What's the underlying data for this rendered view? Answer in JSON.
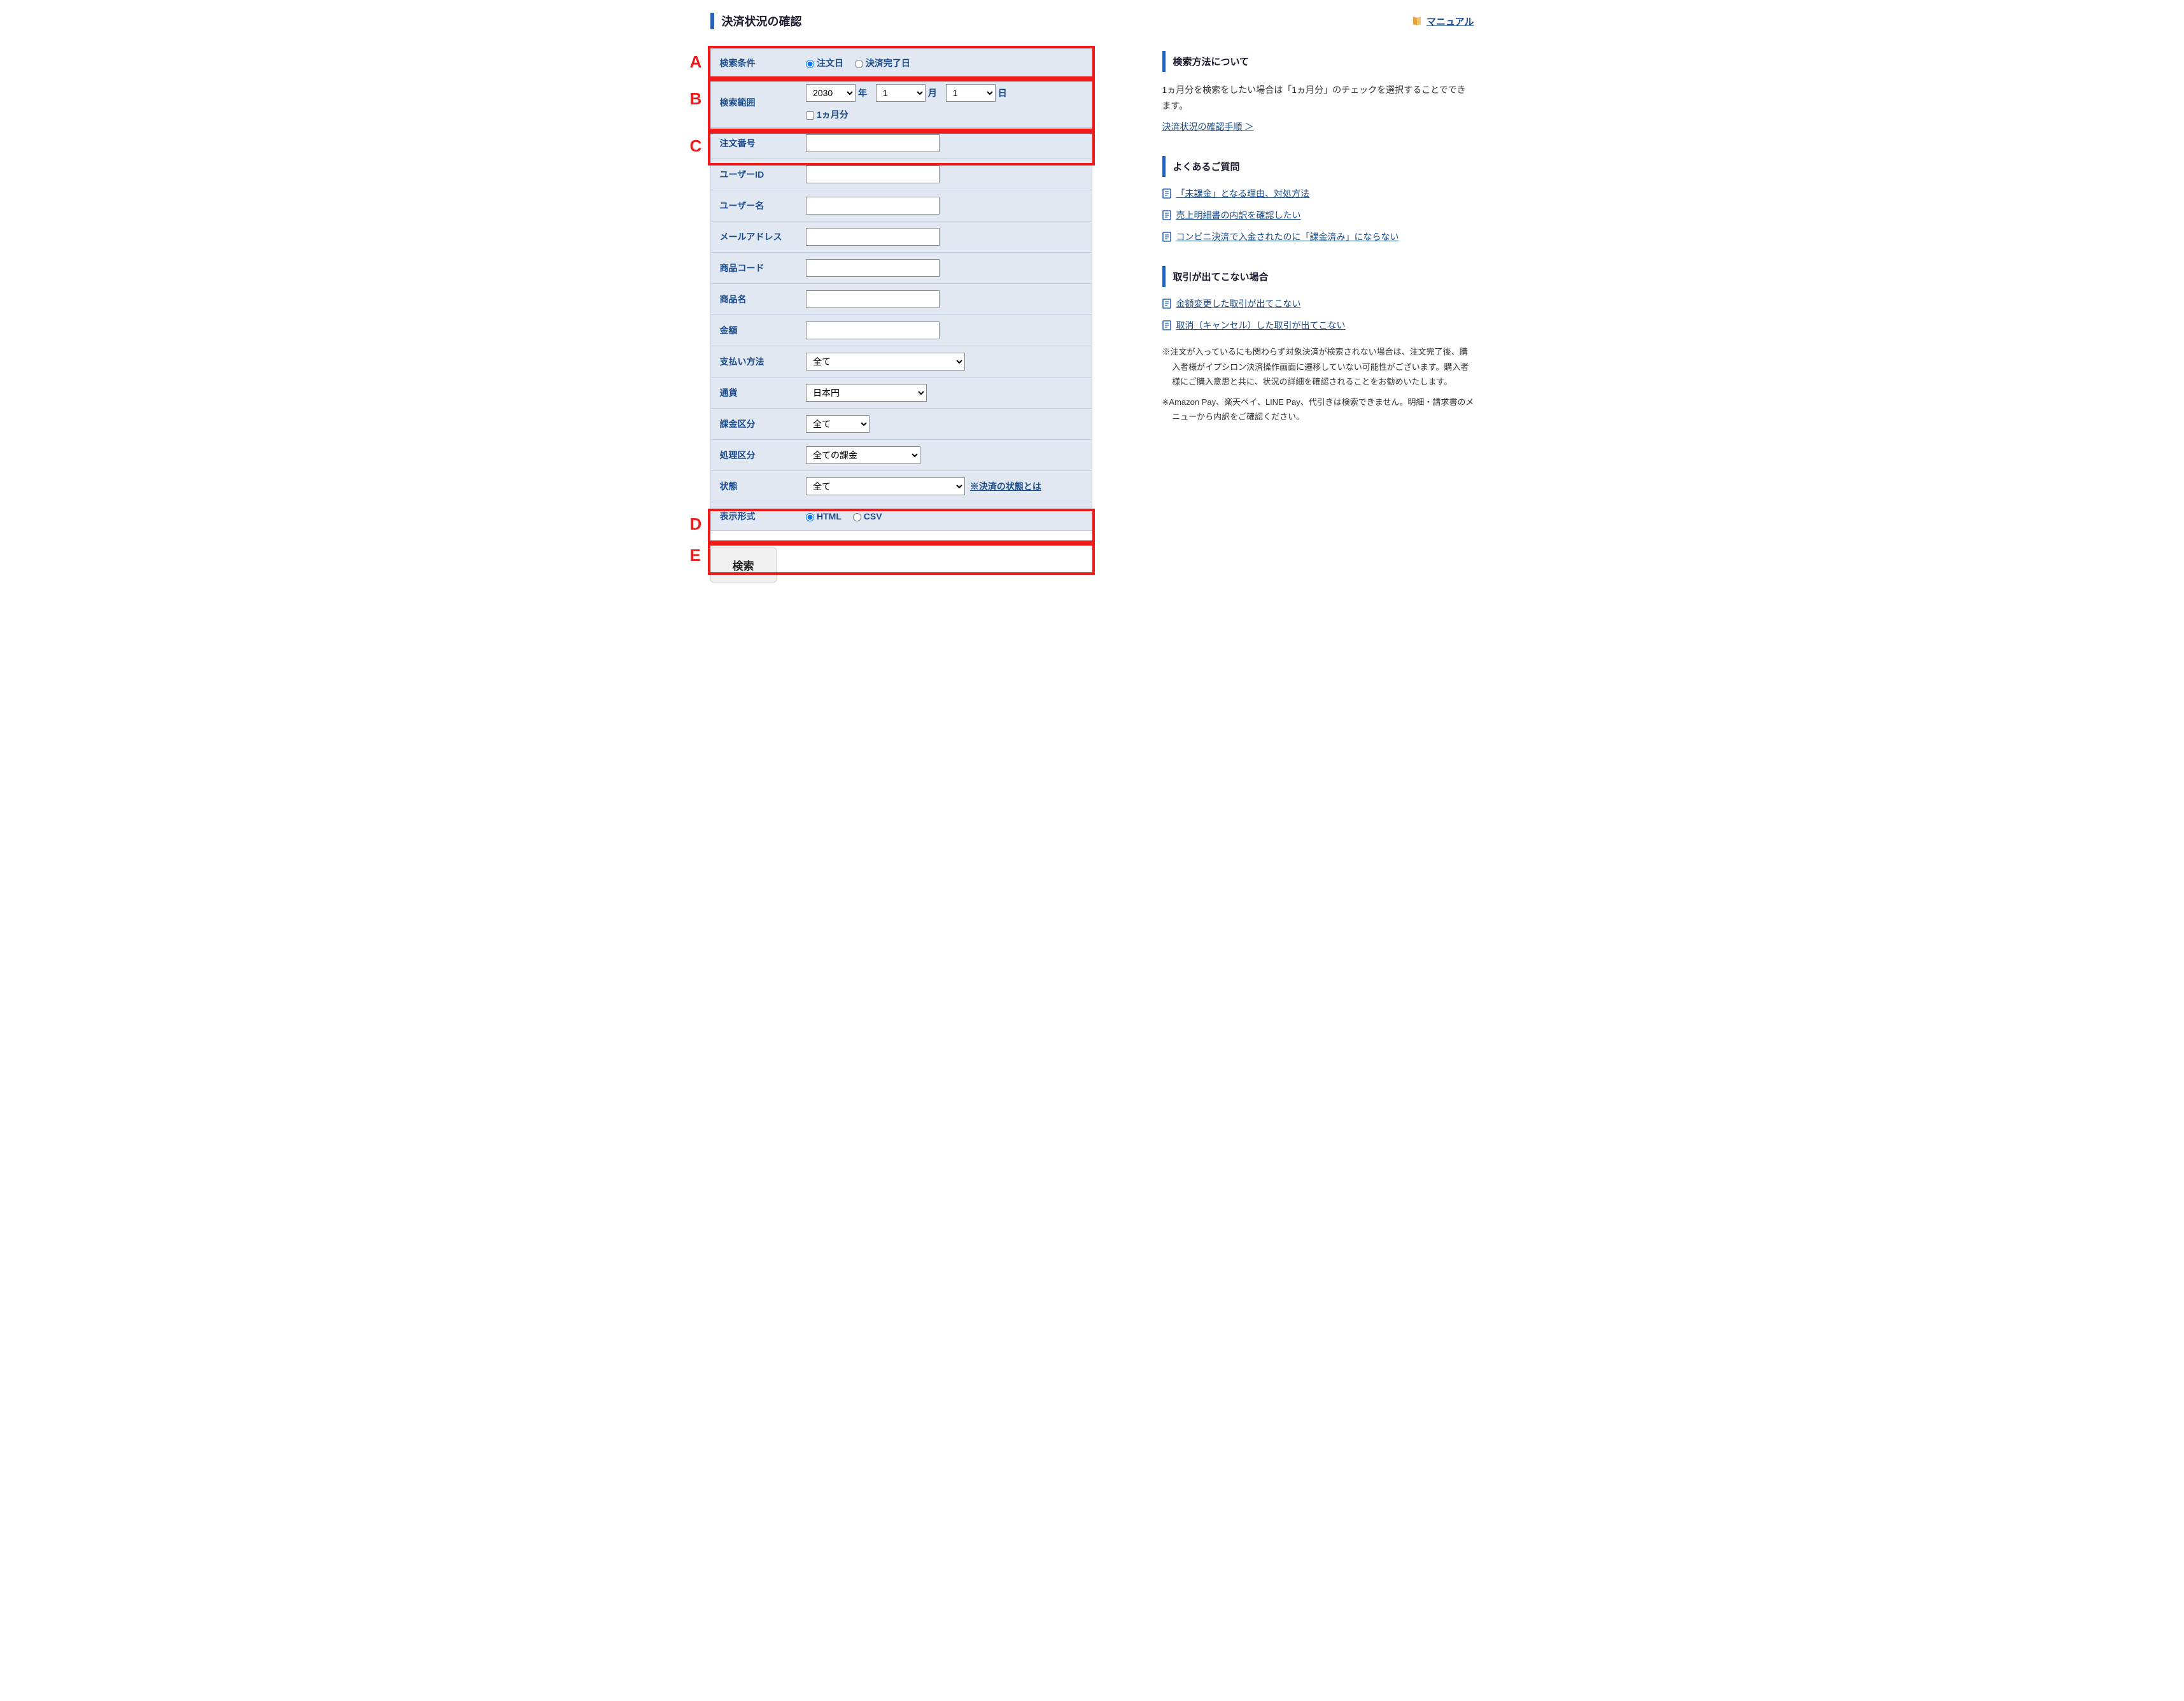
{
  "header": {
    "title": "決済状況の確認",
    "manual_label": "マニュアル"
  },
  "form": {
    "A": {
      "label": "検索条件",
      "opt1": "注文日",
      "opt2": "決済完了日"
    },
    "B": {
      "label": "検索範囲",
      "year": "2030",
      "year_unit": "年",
      "month": "1",
      "month_unit": "月",
      "day": "1",
      "day_unit": "日",
      "one_month": "1ヵ月分"
    },
    "C": {
      "label": "注文番号"
    },
    "user_id": {
      "label": "ユーザーID"
    },
    "user_name": {
      "label": "ユーザー名"
    },
    "email": {
      "label": "メールアドレス"
    },
    "product_code": {
      "label": "商品コード"
    },
    "product_name": {
      "label": "商品名"
    },
    "amount": {
      "label": "金額"
    },
    "payment_method": {
      "label": "支払い方法",
      "selected": "全て"
    },
    "currency": {
      "label": "通貨",
      "selected": "日本円"
    },
    "charge_category": {
      "label": "課金区分",
      "selected": "全て"
    },
    "process_category": {
      "label": "処理区分",
      "selected": "全ての課金"
    },
    "D": {
      "label": "状態",
      "selected": "全て",
      "hint": "※決済の状態とは"
    },
    "E": {
      "label": "表示形式",
      "opt1": "HTML",
      "opt2": "CSV"
    },
    "search_btn": "検索"
  },
  "markers": {
    "A": "A",
    "B": "B",
    "C": "C",
    "D": "D",
    "E": "E"
  },
  "right": {
    "sec1": {
      "title": "検索方法について",
      "text": "1ヵ月分を検索をしたい場合は「1ヵ月分」のチェックを選択することでできます。",
      "link": "決済状況の確認手順 ＞"
    },
    "sec2": {
      "title": "よくあるご質問",
      "items": [
        "「未課金」となる理由、対処方法",
        "売上明細書の内訳を確認したい",
        "コンビニ決済で入金されたのに「課金済み」にならない"
      ]
    },
    "sec3": {
      "title": "取引が出てこない場合",
      "items": [
        "金額変更した取引が出てこない",
        "取消（キャンセル）した取引が出てこない"
      ],
      "note1": "※注文が入っているにも関わらず対象決済が検索されない場合は、注文完了後、購入者様がイプシロン決済操作画面に遷移していない可能性がございます。購入者様にご購入意思と共に、状況の詳細を確認されることをお勧めいたします。",
      "note2": "※Amazon Pay、楽天ペイ、LINE Pay、代引きは検索できません。明細・請求書のメニューから内訳をご確認ください。"
    }
  }
}
